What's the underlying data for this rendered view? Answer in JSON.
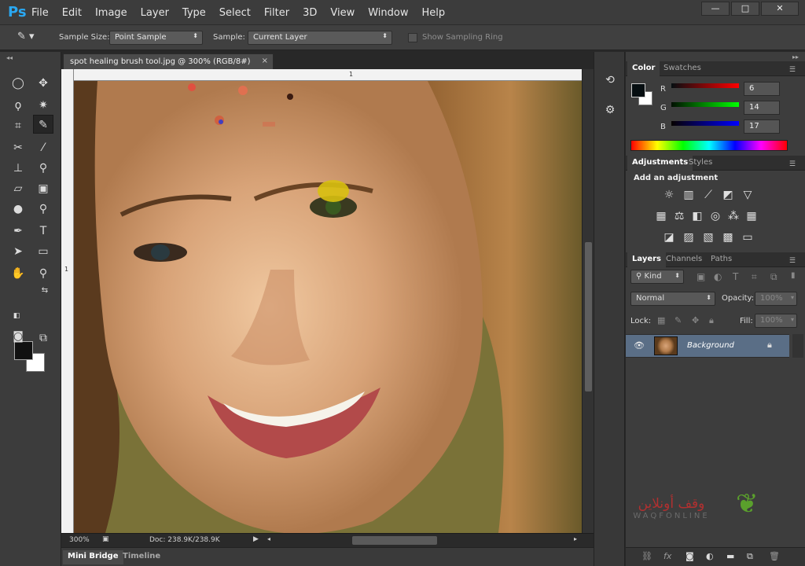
{
  "app": {
    "logo": "Ps"
  },
  "menu": [
    "File",
    "Edit",
    "Image",
    "Layer",
    "Type",
    "Select",
    "Filter",
    "3D",
    "View",
    "Window",
    "Help"
  ],
  "window_controls": {
    "minimize": "—",
    "maximize": "□",
    "close": "✕"
  },
  "options": {
    "sample_size_label": "Sample Size:",
    "sample_size_value": "Point Sample",
    "sample_label": "Sample:",
    "sample_value": "Current Layer",
    "show_ring_label": "Show Sampling Ring"
  },
  "document": {
    "tab_title": "spot healing brush tool.jpg @ 300% (RGB/8#)",
    "tab_close": "×",
    "ruler_h_tick": "1",
    "ruler_v_tick": "1",
    "zoom": "300%",
    "doc_size": "Doc: 238.9K/238.9K"
  },
  "bottom_tabs": [
    "Mini Bridge",
    "Timeline"
  ],
  "color_panel": {
    "tabs": [
      "Color",
      "Swatches"
    ],
    "r_label": "R",
    "r_value": "6",
    "g_label": "G",
    "g_value": "14",
    "b_label": "B",
    "b_value": "17",
    "foreground": "#060e11",
    "background": "#ffffff"
  },
  "adjustments_panel": {
    "tabs": [
      "Adjustments",
      "Styles"
    ],
    "heading": "Add an adjustment"
  },
  "layers_panel": {
    "tabs": [
      "Layers",
      "Channels",
      "Paths"
    ],
    "kind_filter": "Kind",
    "blend_mode": "Normal",
    "opacity_label": "Opacity:",
    "opacity_value": "100%",
    "lock_label": "Lock:",
    "fill_label": "Fill:",
    "fill_value": "100%",
    "layers": [
      {
        "name": "Background",
        "visible": true,
        "locked": true
      }
    ]
  },
  "watermark": {
    "brand": "WAQFONLINE",
    "arabic": "وقف أونلاين"
  },
  "colors": {
    "accent": "#2aa8f2",
    "selected_layer": "#5a6e86"
  }
}
